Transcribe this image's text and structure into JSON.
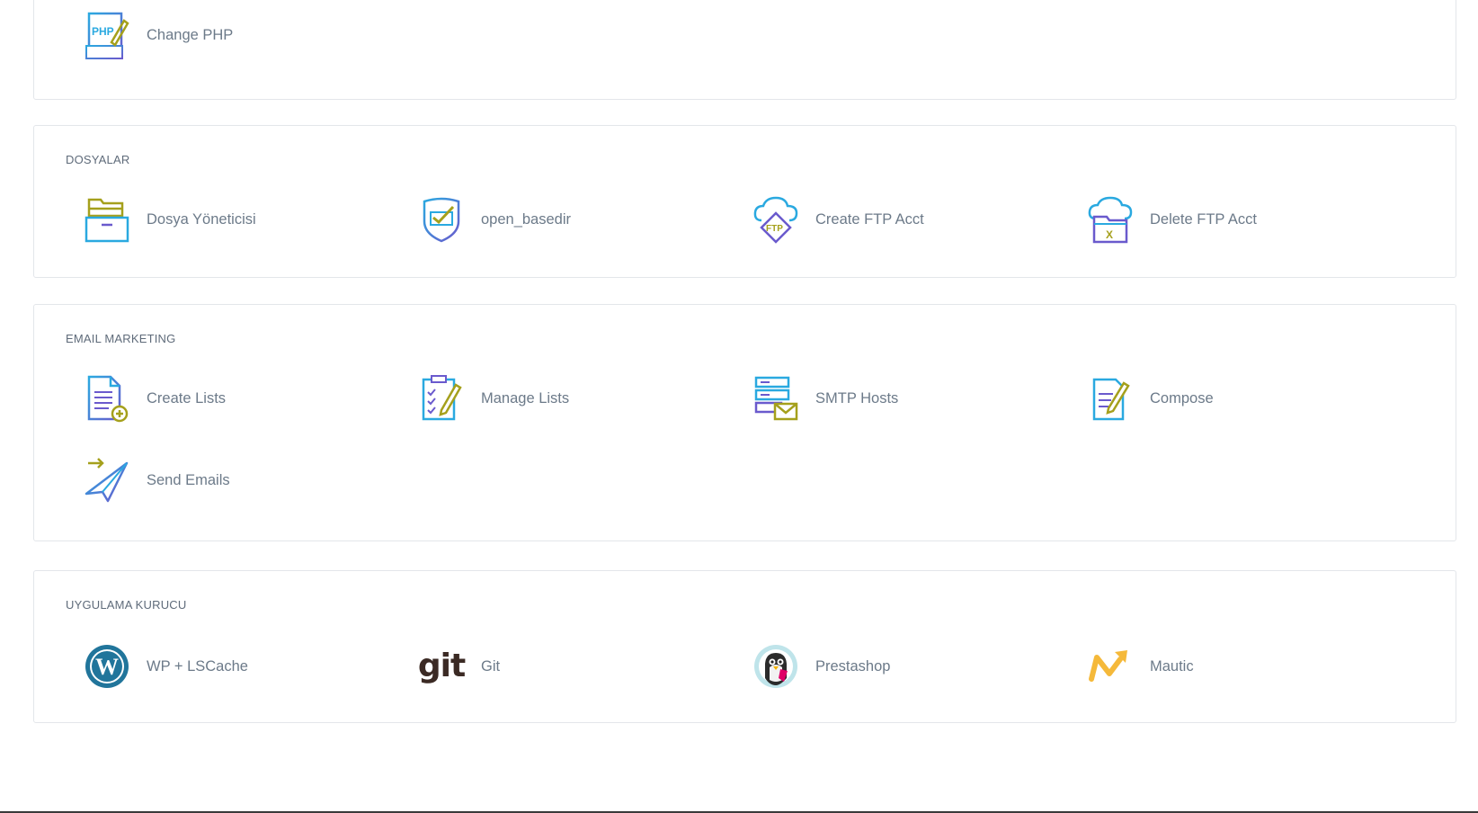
{
  "cards": {
    "php": {
      "items": [
        {
          "label": "Change PHP",
          "icon": "change-php-icon"
        }
      ]
    },
    "files": {
      "title": "DOSYALAR",
      "items": [
        {
          "label": "Dosya Yöneticisi",
          "icon": "file-manager-icon"
        },
        {
          "label": "open_basedir",
          "icon": "shield-check-icon"
        },
        {
          "label": "Create FTP Acct",
          "icon": "ftp-cloud-icon"
        },
        {
          "label": "Delete FTP Acct",
          "icon": "ftp-delete-icon"
        }
      ]
    },
    "email": {
      "title": "EMAIL MARKETING",
      "items": [
        {
          "label": "Create Lists",
          "icon": "document-add-icon"
        },
        {
          "label": "Manage Lists",
          "icon": "checklist-icon"
        },
        {
          "label": "SMTP Hosts",
          "icon": "server-mail-icon"
        },
        {
          "label": "Compose",
          "icon": "compose-icon"
        },
        {
          "label": "Send Emails",
          "icon": "paper-plane-icon"
        }
      ]
    },
    "installer": {
      "title": "UYGULAMA KURUCU",
      "items": [
        {
          "label": "WP + LSCache",
          "icon": "wordpress-icon"
        },
        {
          "label": "Git",
          "icon": "git-icon",
          "icon_text": "git"
        },
        {
          "label": "Prestashop",
          "icon": "prestashop-icon"
        },
        {
          "label": "Mautic",
          "icon": "mautic-icon"
        }
      ]
    }
  },
  "colors": {
    "icon_blue": "#2aa9e0",
    "icon_purple": "#6a5acd",
    "icon_olive": "#a5a01c",
    "text": "#6c7a89",
    "border": "#e3e6ea"
  }
}
